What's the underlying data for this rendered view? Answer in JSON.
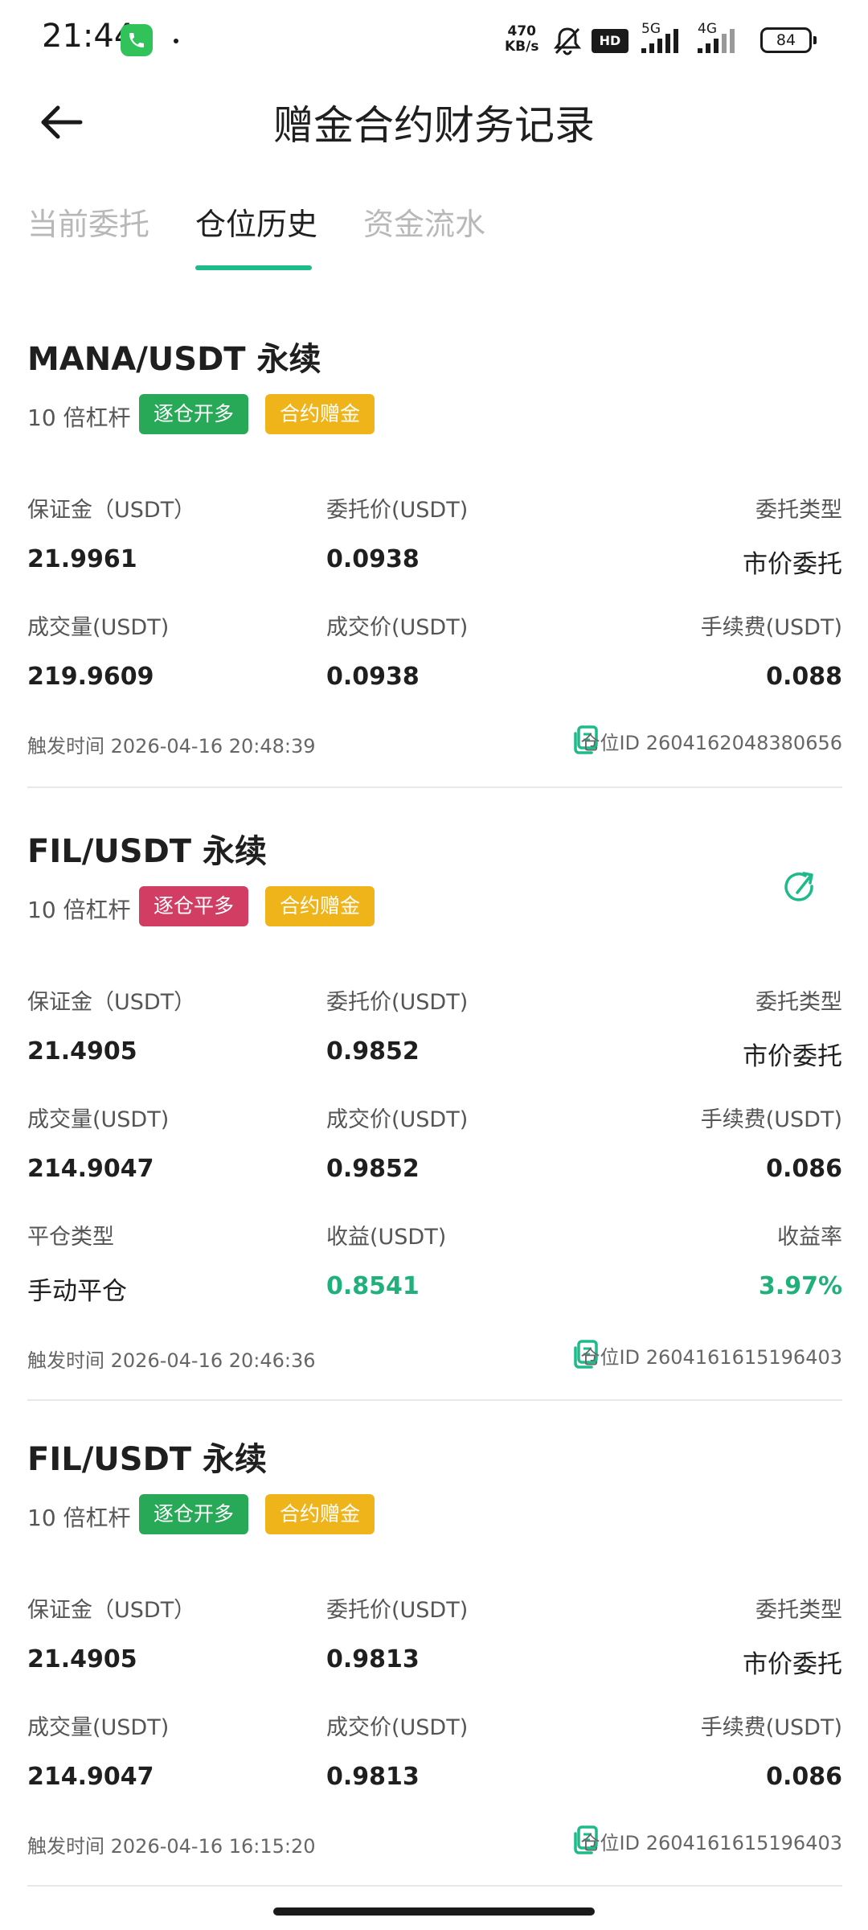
{
  "status_bar": {
    "time": "21:44",
    "speed_value": "470",
    "speed_unit": "KB/s",
    "hd": "HD",
    "net1": "5G",
    "net2": "4G",
    "battery": "84"
  },
  "header": {
    "title": "赠金合约财务记录"
  },
  "tabs": [
    {
      "label": "当前委托"
    },
    {
      "label": "仓位历史"
    },
    {
      "label": "资金流水"
    }
  ],
  "labels": {
    "margin": "保证金（USDT）",
    "order_price": "委托价(USDT)",
    "order_type": "委托类型",
    "volume": "成交量(USDT)",
    "fill_price": "成交价(USDT)",
    "fee": "手续费(USDT)",
    "close_type": "平仓类型",
    "profit": "收益(USDT)",
    "profit_rate": "收益率",
    "trigger_time": "触发时间",
    "position_id": "仓位ID"
  },
  "records": [
    {
      "pair": "MANA/USDT",
      "kind": "永续",
      "leverage": "10 倍杠杆",
      "action": "逐仓开多",
      "bonus": "合约赠金",
      "margin": "21.9961",
      "order_price": "0.0938",
      "order_type": "市价委托",
      "volume": "219.9609",
      "fill_price": "0.0938",
      "fee": "0.088",
      "trigger_time": "2026-04-16 20:48:39",
      "position_id": "2604162048380656"
    },
    {
      "pair": "FIL/USDT",
      "kind": "永续",
      "leverage": "10 倍杠杆",
      "action": "逐仓平多",
      "bonus": "合约赠金",
      "margin": "21.4905",
      "order_price": "0.9852",
      "order_type": "市价委托",
      "volume": "214.9047",
      "fill_price": "0.9852",
      "fee": "0.086",
      "close_type": "手动平仓",
      "profit": "0.8541",
      "profit_rate": "3.97%",
      "trigger_time": "2026-04-16 20:46:36",
      "position_id": "2604161615196403"
    },
    {
      "pair": "FIL/USDT",
      "kind": "永续",
      "leverage": "10 倍杠杆",
      "action": "逐仓开多",
      "bonus": "合约赠金",
      "margin": "21.4905",
      "order_price": "0.9813",
      "order_type": "市价委托",
      "volume": "214.9047",
      "fill_price": "0.9813",
      "fee": "0.086",
      "trigger_time": "2026-04-16 16:15:20",
      "position_id": "2604161615196403"
    }
  ],
  "colors": {
    "accent": "#1dba8a",
    "open_long": "#27a957",
    "close_long": "#d23d64",
    "bonus": "#f0b41b",
    "profit": "#20b07b"
  },
  "icons": {
    "back": "arrow-left-icon",
    "copy": "copy-icon",
    "share": "share-refresh-icon"
  }
}
